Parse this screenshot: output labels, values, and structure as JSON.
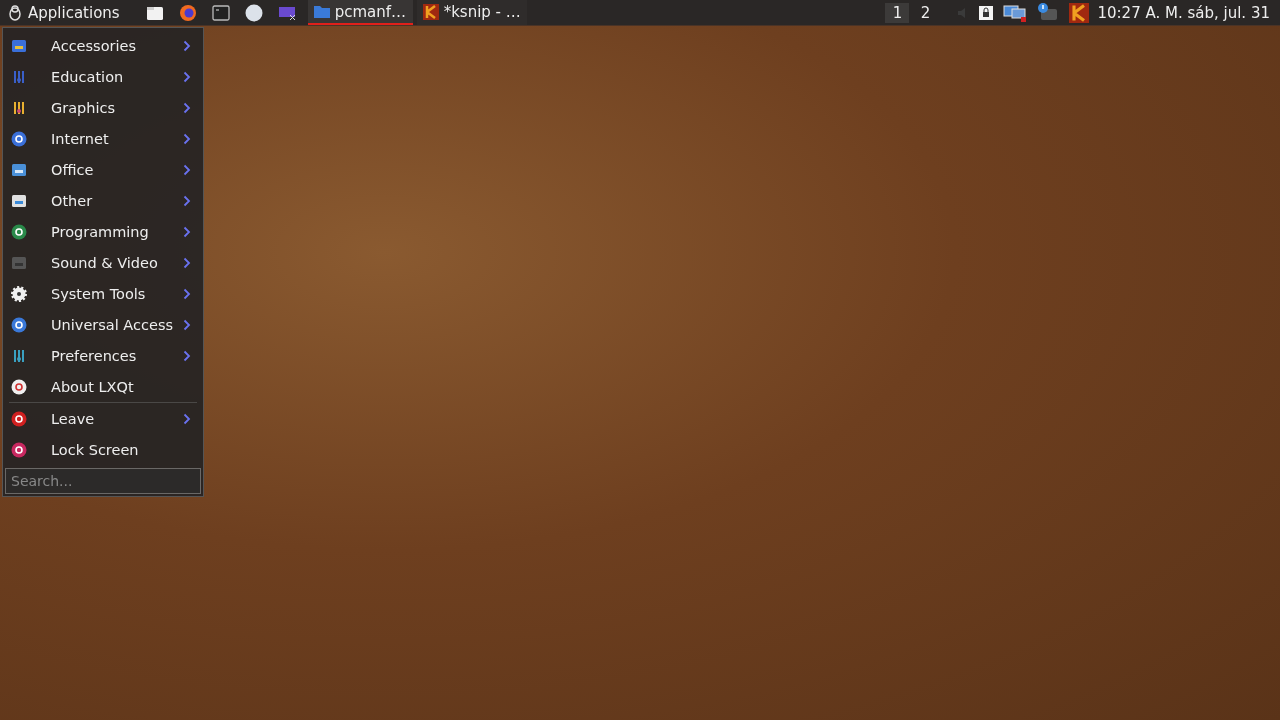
{
  "panel": {
    "menu_button": {
      "label": "Applications"
    },
    "tasks": [
      {
        "title": "pcmanf…",
        "selected": true
      },
      {
        "title": "*ksnip - …",
        "selected": false
      }
    ],
    "workspaces": [
      {
        "label": "1",
        "selected": true
      },
      {
        "label": "2",
        "selected": false
      }
    ],
    "clock": "10:27 A. M. sáb, jul. 31"
  },
  "menu": {
    "groups": [
      [
        {
          "label": "Accessories",
          "has_submenu": true
        },
        {
          "label": "Education",
          "has_submenu": true
        },
        {
          "label": "Graphics",
          "has_submenu": true
        },
        {
          "label": "Internet",
          "has_submenu": true
        },
        {
          "label": "Office",
          "has_submenu": true
        },
        {
          "label": "Other",
          "has_submenu": true
        },
        {
          "label": "Programming",
          "has_submenu": true
        },
        {
          "label": "Sound & Video",
          "has_submenu": true
        },
        {
          "label": "System Tools",
          "has_submenu": true
        },
        {
          "label": "Universal Access",
          "has_submenu": true
        },
        {
          "label": "Preferences",
          "has_submenu": true
        },
        {
          "label": "About LXQt",
          "has_submenu": false
        }
      ],
      [
        {
          "label": "Leave",
          "has_submenu": true
        },
        {
          "label": "Lock Screen",
          "has_submenu": false
        }
      ]
    ],
    "search": {
      "placeholder": "Search..."
    }
  }
}
